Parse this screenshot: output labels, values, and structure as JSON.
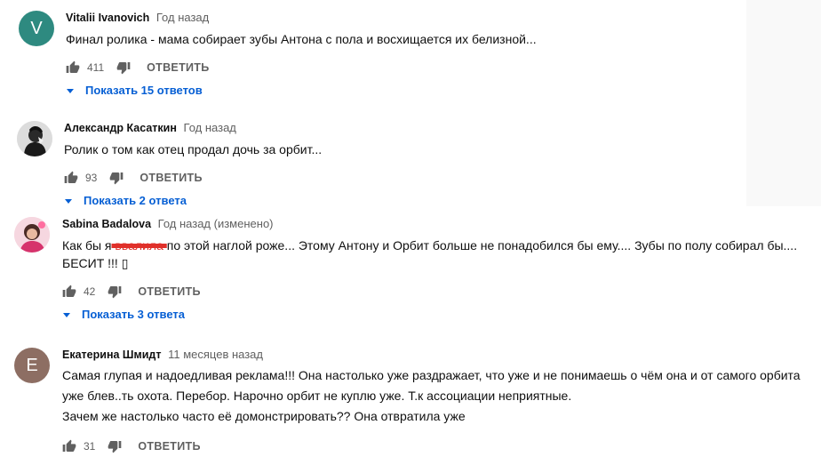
{
  "comments": [
    {
      "author": "Vitalii Ivanovich",
      "time": "Год назад",
      "avatar_letter": "V",
      "avatar_color": "#2e8a80",
      "text": "Финал ролика - мама собирает зубы Антона с пола и восхищается их белизной...",
      "likes": "411",
      "reply_label": "ОТВЕТИТЬ",
      "replies_label": "Показать 15 ответов"
    },
    {
      "author": "Александр Касаткин",
      "time": "Год назад",
      "avatar_icon": "photo-avatar",
      "text": "Ролик о том как отец продал дочь за орбит...",
      "likes": "93",
      "reply_label": "ОТВЕТИТЬ",
      "replies_label": "Показать 2 ответа"
    },
    {
      "author": "Sabina Badalova",
      "time": "Год назад (изменено)",
      "avatar_icon": "photo-avatar",
      "text_before": "Как бы я",
      "text_redacted": " ввалила ",
      "text_after": "по этой наглой роже... Этому Антону и Орбит больше не понадобился бы ему.... Зубы по полу собирал бы.... БЕСИТ !!! ▯",
      "likes": "42",
      "reply_label": "ОТВЕТИТЬ",
      "replies_label": "Показать 3 ответа"
    },
    {
      "author": "Екатерина Шмидт",
      "time": "11 месяцев назад",
      "avatar_letter": "E",
      "avatar_color": "#8d6e63",
      "text_lines": [
        "Самая глупая и надоедливая реклама!!! Она настолько уже раздражает, что уже и не понимаешь о чём она и от самого орбита",
        "уже блев..ть охота. Перебор. Нарочно орбит не куплю уже. Т.к ассоциации неприятные.",
        "Зачем же настолько часто её домонстрировать?? Она отвратила уже"
      ],
      "likes": "31",
      "reply_label": "ОТВЕТИТЬ"
    }
  ]
}
